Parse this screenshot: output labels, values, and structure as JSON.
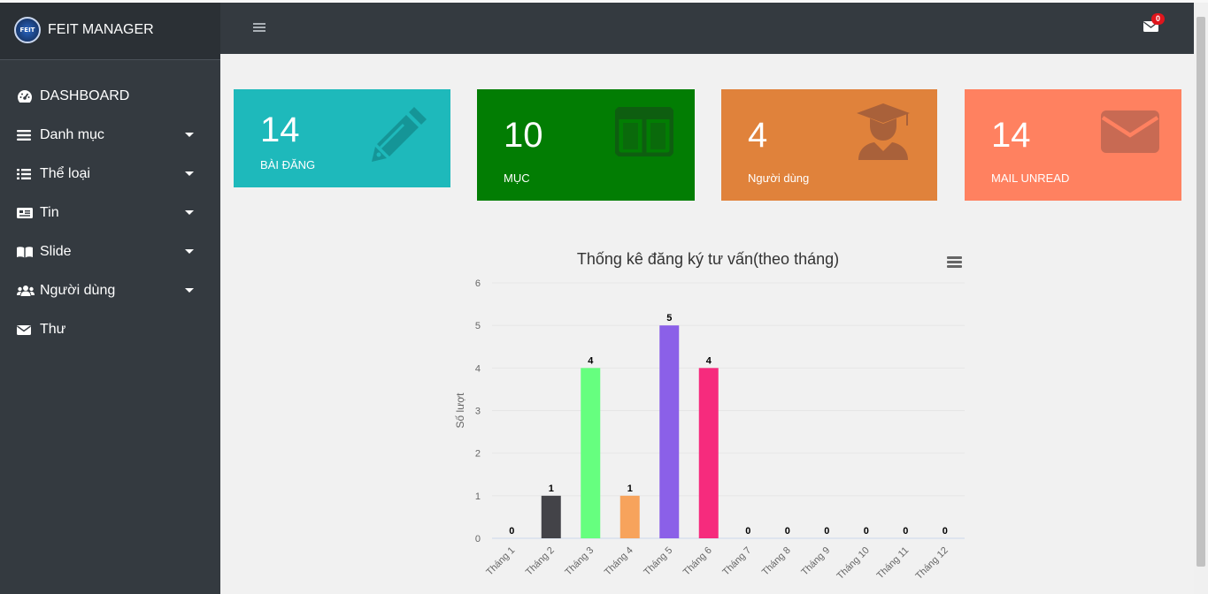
{
  "brand": {
    "title": "FEIT MANAGER",
    "logo_text": "FEIT"
  },
  "sidebar": {
    "items": [
      {
        "label": "DASHBOARD",
        "icon": "tachometer-icon",
        "has_caret": false
      },
      {
        "label": "Danh mục",
        "icon": "bars-icon",
        "has_caret": true
      },
      {
        "label": "Thể loại",
        "icon": "list-icon",
        "has_caret": true
      },
      {
        "label": "Tin",
        "icon": "newspaper-icon",
        "has_caret": true
      },
      {
        "label": "Slide",
        "icon": "book-icon",
        "has_caret": true
      },
      {
        "label": "Người dùng",
        "icon": "users-icon",
        "has_caret": true
      },
      {
        "label": "Thư",
        "icon": "envelope-icon",
        "has_caret": false
      }
    ]
  },
  "header": {
    "mail_badge": "0"
  },
  "cards": [
    {
      "value": "14",
      "label": "BÀI ĐĂNG",
      "color": "#1eb9bb",
      "icon": "pencil-icon"
    },
    {
      "value": "10",
      "label": "MỤC",
      "color": "#027d03",
      "icon": "columns-icon"
    },
    {
      "value": "4",
      "label": "Người dùng",
      "color": "#e0823b",
      "icon": "graduate-user-icon"
    },
    {
      "value": "14",
      "label": "MAIL UNREAD",
      "color": "#ff8160",
      "icon": "envelope-icon"
    }
  ],
  "chart_data": {
    "type": "bar",
    "title": "Thống kê đăng ký tư vấn(theo tháng)",
    "ylabel": "Số lượt",
    "xlabel": "",
    "ylim": [
      0,
      6
    ],
    "yticks": [
      "0",
      "1",
      "2",
      "3",
      "4",
      "5",
      "6"
    ],
    "categories": [
      "Tháng 1",
      "Tháng 2",
      "Tháng 3",
      "Tháng 4",
      "Tháng 5",
      "Tháng 6",
      "Tháng 7",
      "Tháng 8",
      "Tháng 9",
      "Tháng 10",
      "Tháng 11",
      "Tháng 12"
    ],
    "values": [
      0,
      1,
      4,
      1,
      5,
      4,
      0,
      0,
      0,
      0,
      0,
      0
    ],
    "colors": [
      "#7cb5ec",
      "#434348",
      "#66ff7f",
      "#f7a35c",
      "#8b60e8",
      "#f62b7d",
      "#e4d354",
      "#2b908f",
      "#f45b5b",
      "#91e8e1",
      "#7cb5ec",
      "#434348"
    ],
    "grid": true,
    "legend": "none"
  }
}
